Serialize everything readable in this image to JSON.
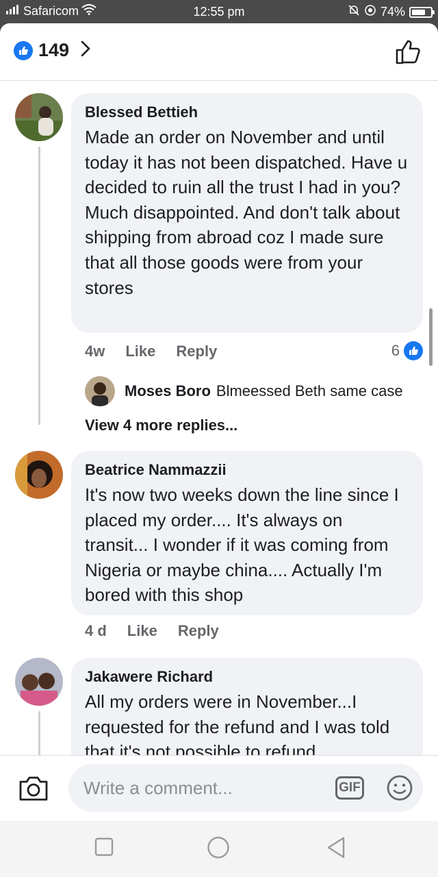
{
  "status_bar": {
    "carrier": "Safaricom",
    "time": "12:55 pm",
    "battery": "74%",
    "battery_level": 0.74
  },
  "header": {
    "like_count": "149"
  },
  "comments": [
    {
      "author": "Blessed Bettieh",
      "text": "Made an order on November and until today it has not been dispatched.  Have u decided to ruin all the trust I had in you?  Much disappointed.  And don't talk about shipping from abroad coz I made sure that all those goods were from your stores",
      "time": "4w",
      "like_label": "Like",
      "reply_label": "Reply",
      "reaction_count": "6",
      "reply": {
        "author": "Moses Boro",
        "text": "Blmeessed Beth same case"
      },
      "more_replies": "View 4 more replies..."
    },
    {
      "author": "Beatrice Nammazzii",
      "text": "It's now two weeks down the line since I placed my order.... It's always on transit... I wonder if it was coming from Nigeria or maybe china.... Actually I'm bored with this shop",
      "time": "4 d",
      "like_label": "Like",
      "reply_label": "Reply"
    },
    {
      "author": "Jakawere Richard",
      "text": "All my orders were in November...I requested for the refund and I was told that it's not possible to refund"
    }
  ],
  "composer": {
    "placeholder": "Write a comment...",
    "gif_label": "GIF"
  },
  "colors": {
    "accent": "#1877f2",
    "bubble": "#f0f2f5",
    "secondary_text": "#65676b"
  }
}
